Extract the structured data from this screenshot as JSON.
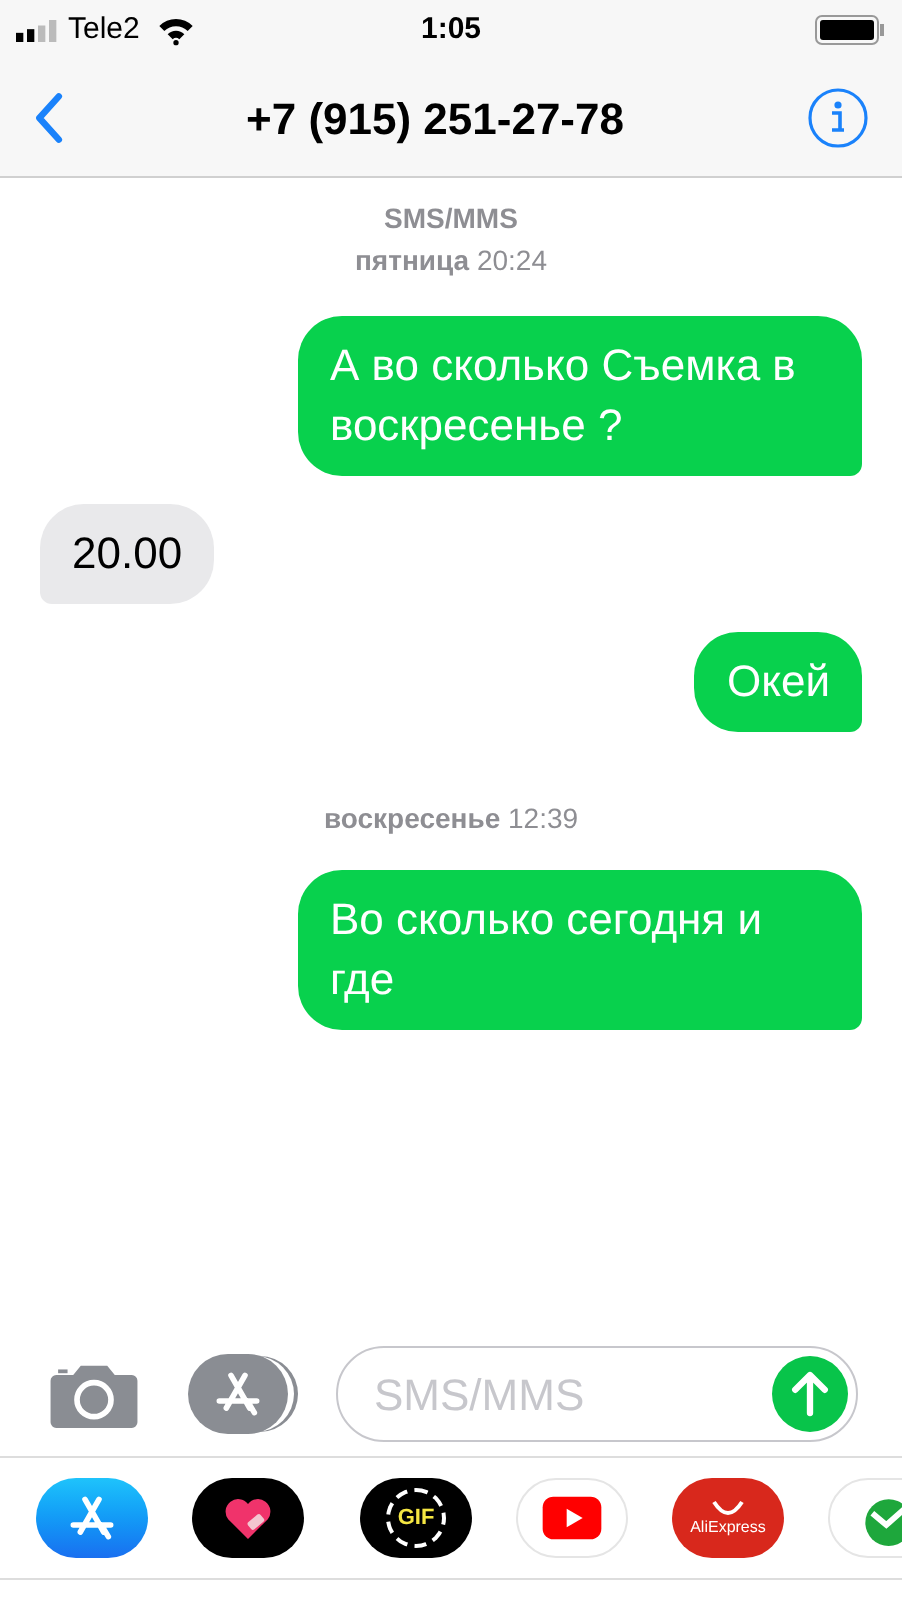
{
  "status_bar": {
    "carrier": "Tele2",
    "time": "1:05"
  },
  "header": {
    "title": "+7 (915) 251-27-78"
  },
  "thread": [
    {
      "kind": "service",
      "text": "SMS/MMS"
    },
    {
      "kind": "time",
      "text": "**пятница** 20:24"
    },
    {
      "kind": "message",
      "from_me": true,
      "text": "А во сколько Съемка в воскресенье ?"
    },
    {
      "kind": "message",
      "from_me": false,
      "text": "20.00"
    },
    {
      "kind": "message",
      "from_me": true,
      "text": "Окей"
    },
    {
      "kind": "time",
      "text": "**воскресенье** 12:39"
    },
    {
      "kind": "message",
      "from_me": true,
      "text": "Во сколько сегодня и где"
    }
  ],
  "composer": {
    "placeholder": "SMS/MMS"
  },
  "app_drawer": [
    {
      "kind": "appstore"
    },
    {
      "kind": "heart"
    },
    {
      "kind": "gif",
      "label": "GIF"
    },
    {
      "kind": "youtube"
    },
    {
      "kind": "aliexpress",
      "label": "AliExpress"
    },
    {
      "kind": "sber"
    }
  ]
}
